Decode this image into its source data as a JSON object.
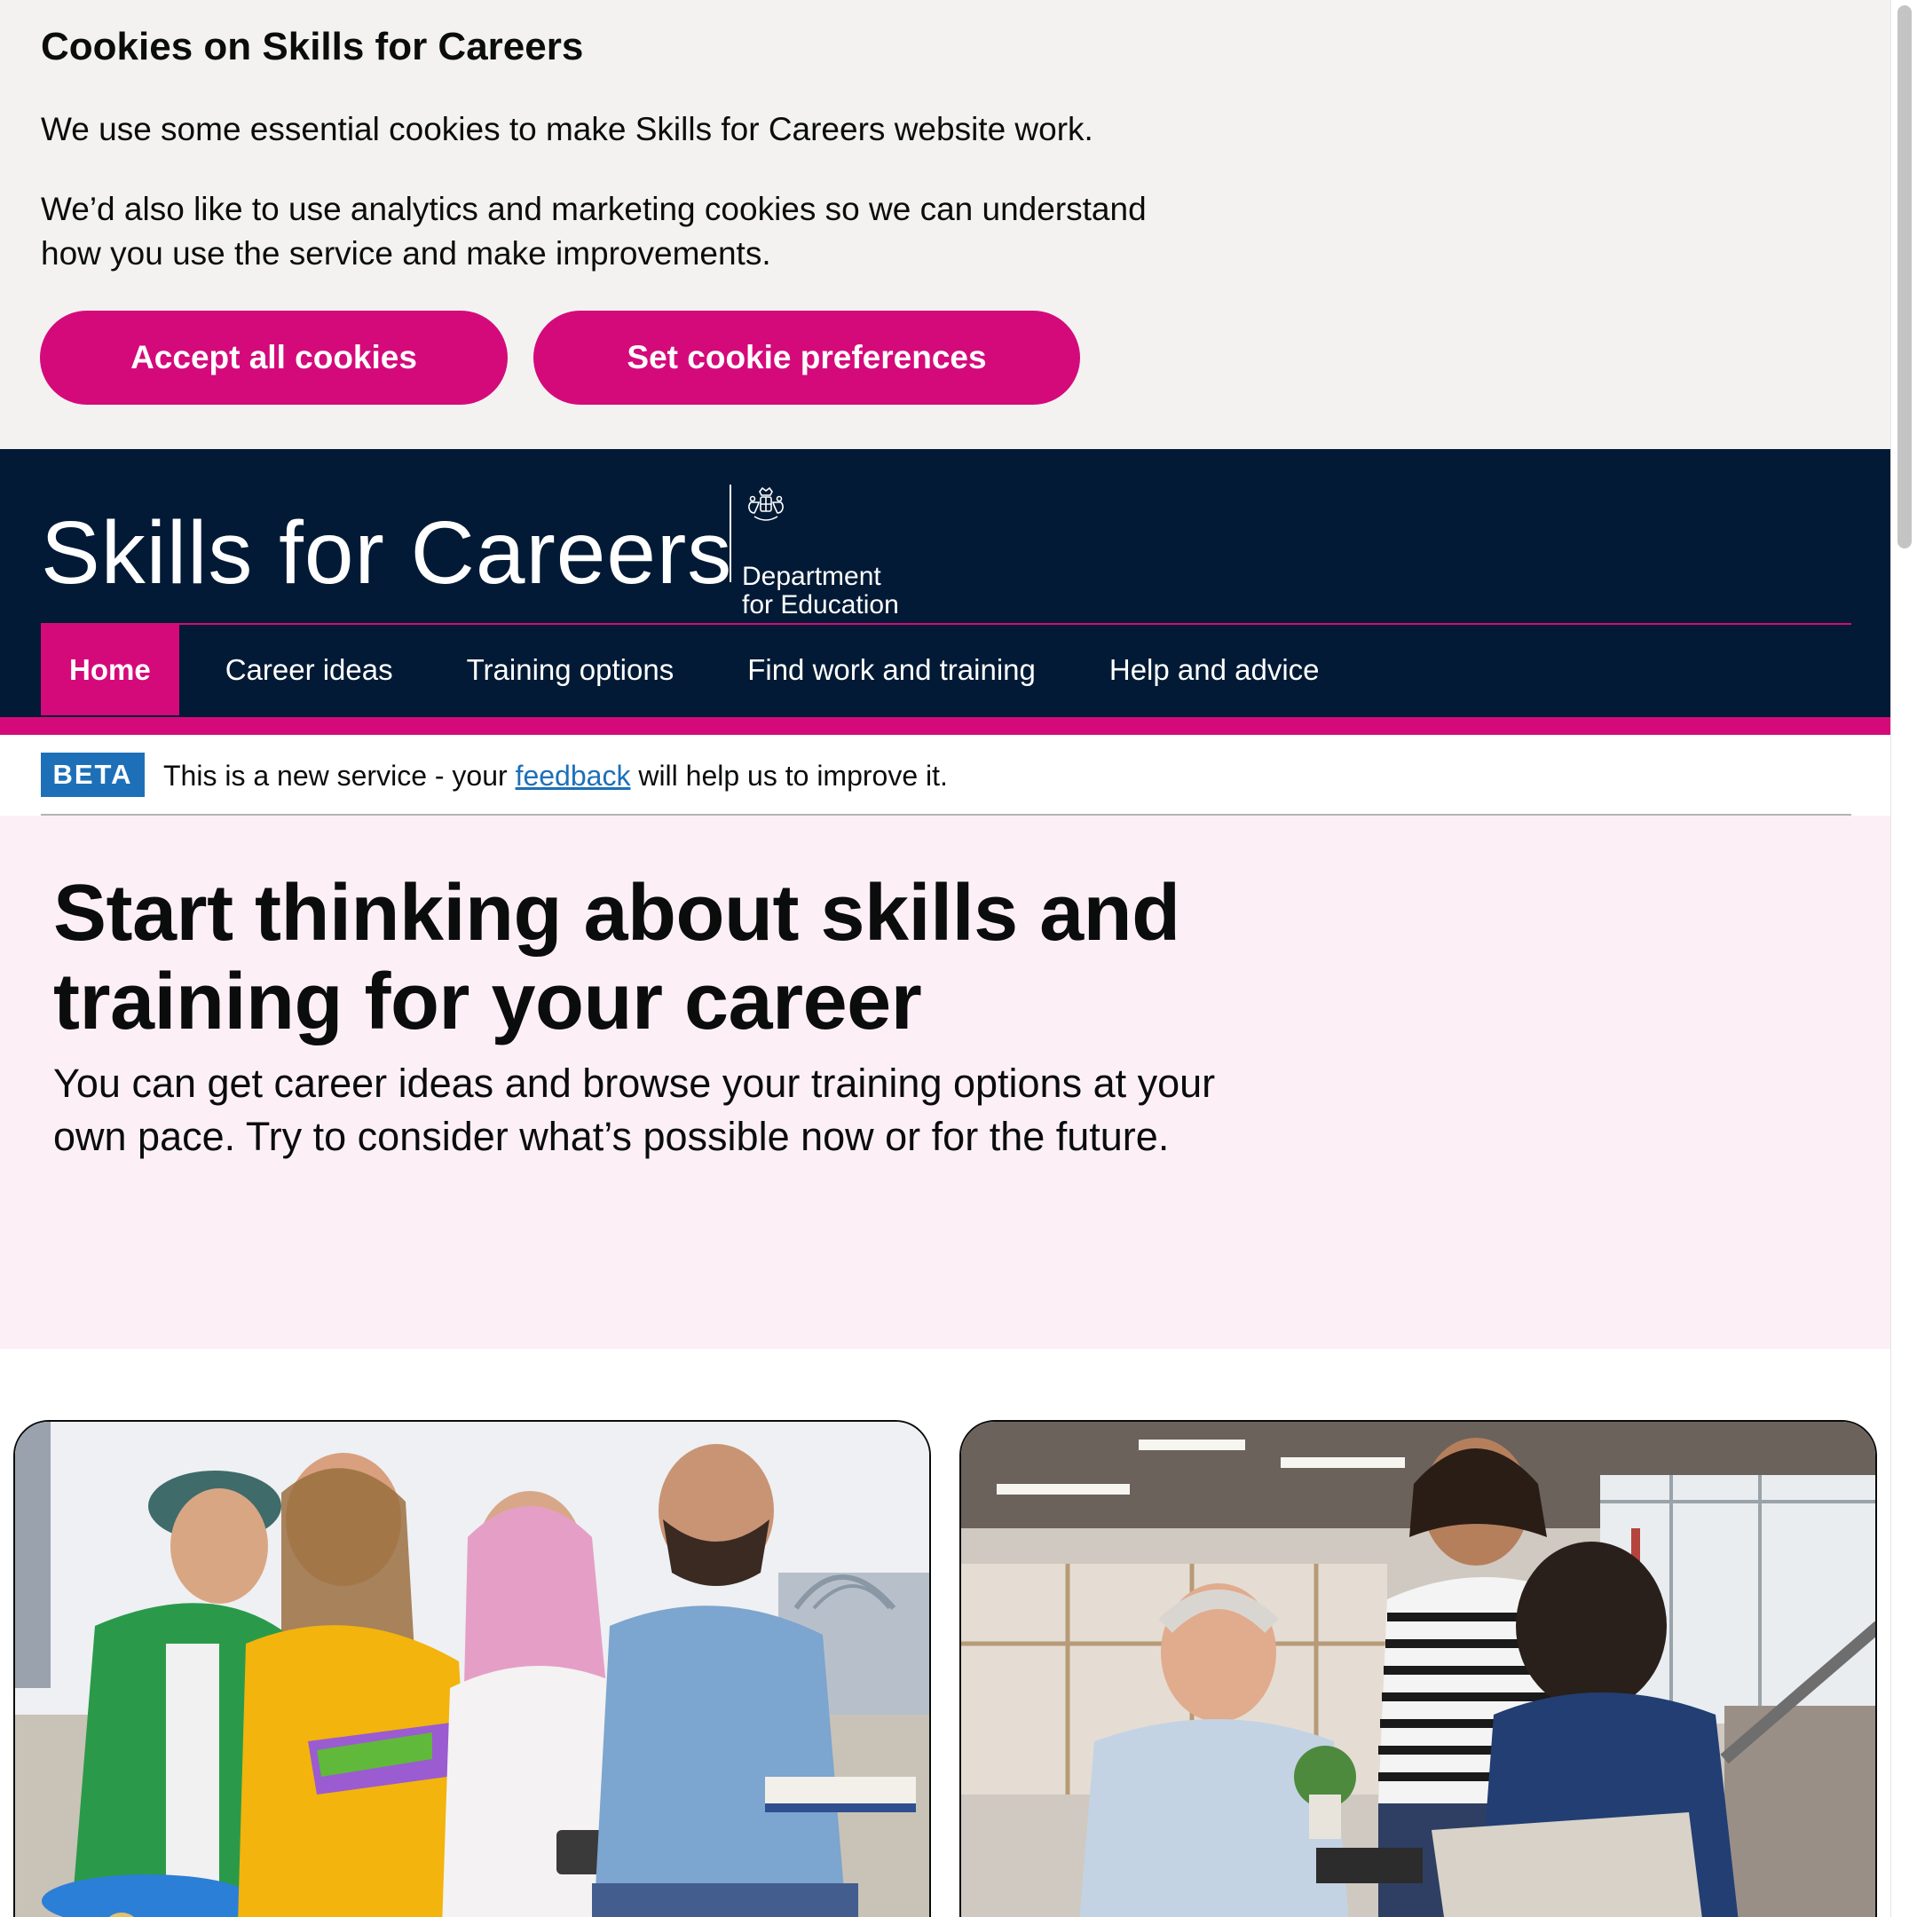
{
  "cookie_banner": {
    "title": "Cookies on Skills for Careers",
    "paragraph_1": "We use some essential cookies to make Skills for Careers website work.",
    "paragraph_2": "We’d also like to use analytics and marketing cookies so we can understand how you use the service and make improvements.",
    "accept_label": "Accept all cookies",
    "preferences_label": "Set cookie preferences"
  },
  "header": {
    "site_title": "Skills for Careers",
    "dfe_line_1": "Department",
    "dfe_line_2": "for Education"
  },
  "nav": {
    "items": [
      {
        "label": "Home",
        "active": true
      },
      {
        "label": "Career ideas",
        "active": false
      },
      {
        "label": "Training options",
        "active": false
      },
      {
        "label": "Find work and training",
        "active": false
      },
      {
        "label": "Help and advice",
        "active": false
      }
    ]
  },
  "beta": {
    "tag": "BETA",
    "text_before": "This is a new service - your ",
    "link": "feedback",
    "text_after": " will help us to improve it."
  },
  "hero": {
    "title": "Start thinking about skills and training for your career",
    "subtitle": "You can get career ideas and browse your training options at your own pace. Try to consider what’s possible now or for the future."
  },
  "cards": [
    {
      "image": "young-people-studying-photo"
    },
    {
      "image": "office-meeting-photo"
    }
  ],
  "colors": {
    "brand_pink": "#d40a7b",
    "header_navy": "#021a35",
    "beta_blue": "#1d70b8",
    "hero_background": "#fcf0f6",
    "banner_background": "#f3f2f1"
  }
}
